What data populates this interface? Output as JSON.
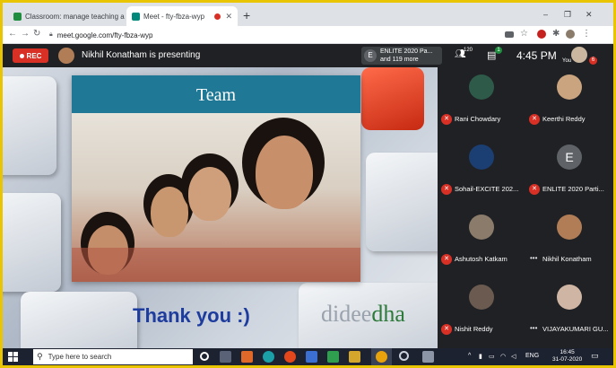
{
  "browser": {
    "tabs": [
      {
        "title": "Classroom: manage teaching an",
        "close": "✕"
      },
      {
        "title": "Meet - fty-fbza-wyp",
        "close": "✕"
      }
    ],
    "new_tab": "+",
    "window_controls": {
      "minimize": "–",
      "restore": "❐",
      "close": "✕"
    },
    "url": "meet.google.com/fty-fbza-wyp"
  },
  "meet_bar": {
    "rec_label": "REC",
    "presenting_text": "Nikhil Konatham is presenting",
    "group_badge": {
      "letter": "E",
      "line1": "ENLITE 2020 Pa...",
      "line2": "and 119 more"
    },
    "people_count": "120",
    "chat_badge": "1",
    "time": "4:45 PM",
    "you_label": "You",
    "you_badge": "6"
  },
  "slide": {
    "title": "Team",
    "thank_text": "Thank you :)",
    "brand_part1": "didee",
    "brand_part2": "dha"
  },
  "participants": [
    {
      "name": "Rani Chowdary",
      "muted": true,
      "avatar": "photo",
      "color": "#2e5a4a"
    },
    {
      "name": "Keerthi Reddy",
      "muted": true,
      "avatar": "photo",
      "color": "#c9a47f"
    },
    {
      "name": "Sohail-EXCITE 202...",
      "muted": true,
      "avatar": "photo",
      "color": "#1b3f72"
    },
    {
      "name": "ENLITE 2020 Parti...",
      "muted": true,
      "avatar": "letter",
      "letter": "E",
      "color": "#5f6368"
    },
    {
      "name": "Ashutosh Katkam",
      "muted": true,
      "avatar": "photo",
      "color": "#8a7b6a"
    },
    {
      "name": "Nikhil Konatham",
      "muted": false,
      "avatar": "photo",
      "color": "#b07d56"
    },
    {
      "name": "Nishit Reddy",
      "muted": true,
      "avatar": "photo",
      "color": "#6a5a4f"
    },
    {
      "name": "VIJAYAKUMARI GU...",
      "muted": false,
      "avatar": "photo",
      "color": "#cfb6a4"
    }
  ],
  "taskbar": {
    "search_placeholder": "Type here to search",
    "lang": "ENG",
    "time": "16:45",
    "date": "31-07-2020"
  },
  "colors": {
    "meet_dark": "#202124",
    "rec_red": "#d93025",
    "slide_blue": "#1f7895",
    "thank_blue": "#1d3c9e"
  }
}
